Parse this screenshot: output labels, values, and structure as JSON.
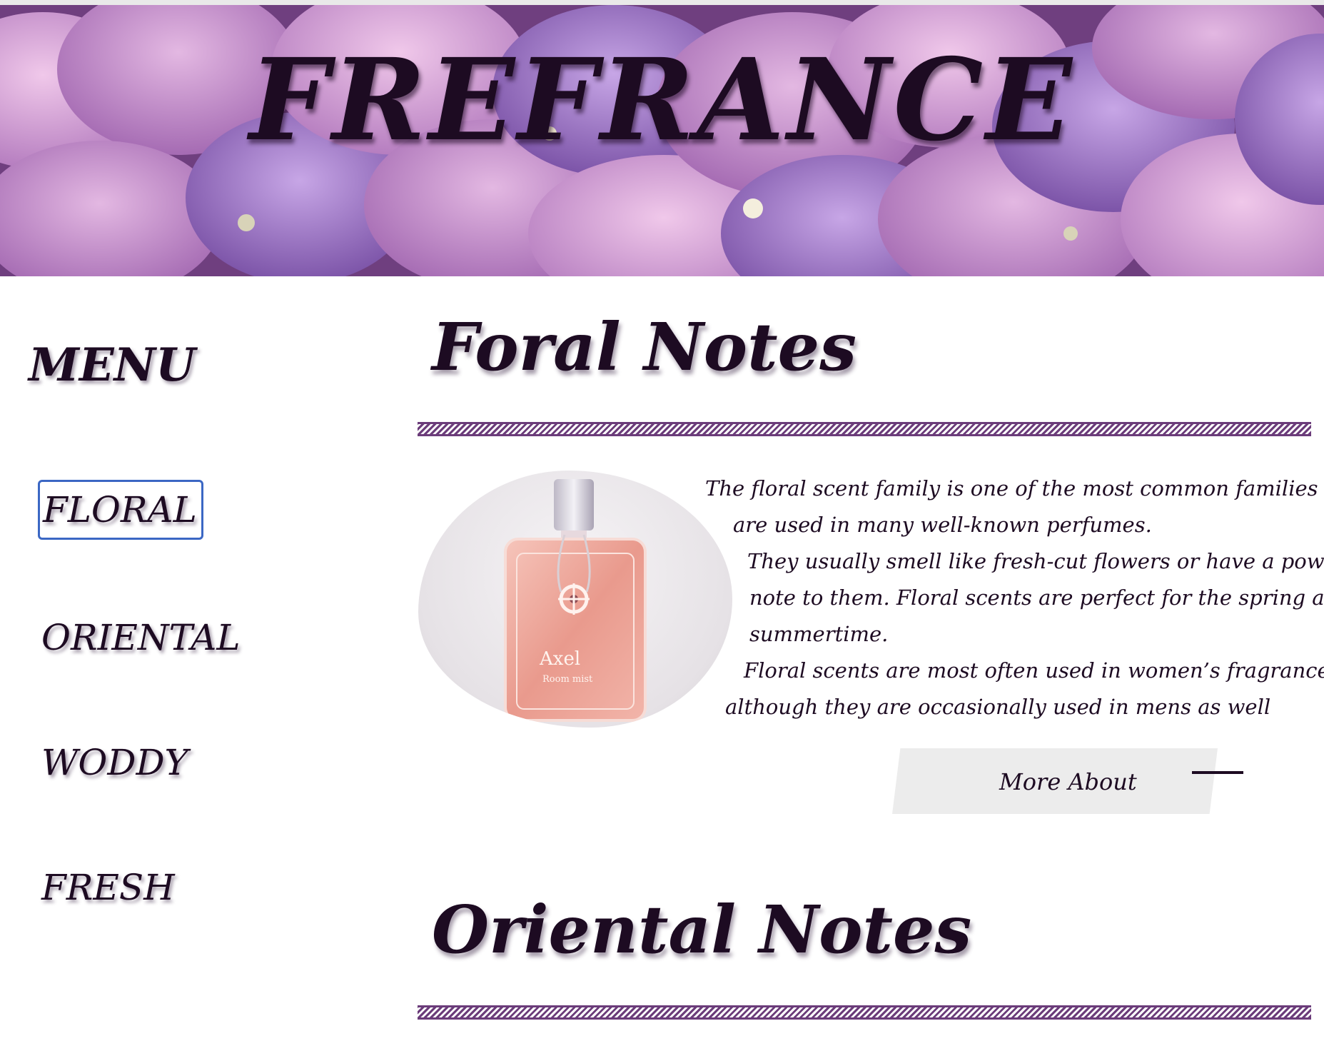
{
  "header": {
    "title": "FREFRANCE"
  },
  "menu": {
    "title": "MENU",
    "items": [
      {
        "label": "FLORAL",
        "active": true
      },
      {
        "label": "ORIENTAL",
        "active": false
      },
      {
        "label": "WODDY",
        "active": false
      },
      {
        "label": "FRESH",
        "active": false
      }
    ]
  },
  "sections": [
    {
      "title": "Foral Notes",
      "image_label": "Axel",
      "image_sublabel": "Room mist",
      "description_lines": [
        "The floral scent family is one of the most common families and",
        "are used in many well-known perfumes.",
        "They usually smell like fresh-cut flowers or have a powdery",
        "note to them. Floral scents are perfect for the spring and",
        "summertime.",
        "Floral scents are most often used in women’s fragrances,",
        "although they are occasionally used in mens as well"
      ],
      "button_label": "More About"
    },
    {
      "title": "Oriental Notes"
    }
  ],
  "colors": {
    "text": "#1d0b22",
    "accent_stripe": "#6b3c7a",
    "active_outline": "#3b67c4",
    "button_bg": "#ececec"
  }
}
